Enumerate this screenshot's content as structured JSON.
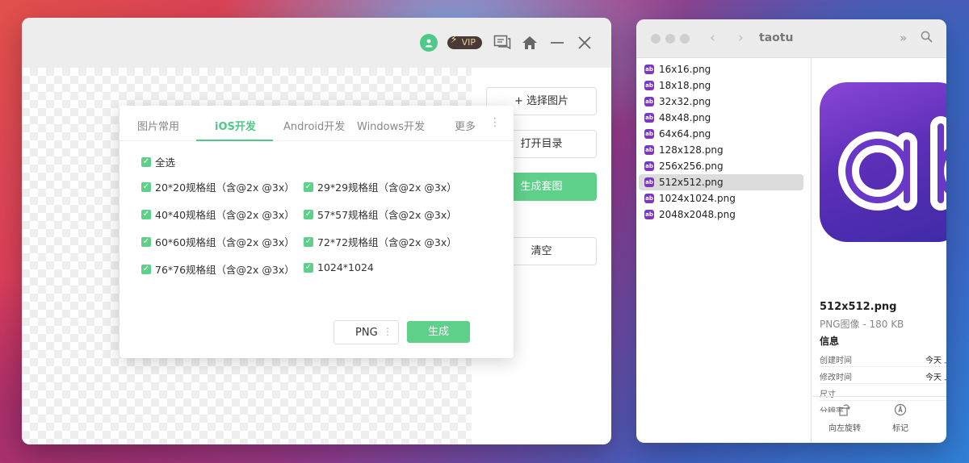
{
  "app": {
    "vip_label": "VIP",
    "sidebar_buttons": {
      "select_image": "+ 选择图片",
      "open_dir": "打开目录",
      "generate_set": "生成套图",
      "clear": "清空"
    },
    "dialog": {
      "tabs": [
        "图片常用",
        "iOS开发",
        "Android开发",
        "Windows开发",
        "更多"
      ],
      "active_tab": "iOS开发",
      "select_all": "全选",
      "options": [
        "20*20规格组（含@2x @3x）",
        "29*29规格组（含@2x @3x）",
        "40*40规格组（含@2x @3x）",
        "57*57规格组（含@2x @3x）",
        "60*60规格组（含@2x @3x）",
        "72*72规格组（含@2x @3x）",
        "76*76规格组（含@2x @3x）",
        "1024*1024"
      ],
      "format": "PNG",
      "generate": "生成"
    }
  },
  "finder": {
    "title": "taotu",
    "files": [
      "16x16.png",
      "18x18.png",
      "32x32.png",
      "48x48.png",
      "64x64.png",
      "128x128.png",
      "256x256.png",
      "512x512.png",
      "1024x1024.png",
      "2048x2048.png"
    ],
    "selected_file": "512x512.png",
    "preview": {
      "name": "512x512.png",
      "kind": "PNG图像 - 180 KB",
      "info_heading": "信息",
      "info": [
        {
          "key": "创建时间",
          "value": "今天 上"
        },
        {
          "key": "修改时间",
          "value": "今天 上"
        },
        {
          "key": "尺寸",
          "value": ""
        },
        {
          "key": "分辨率",
          "value": ""
        }
      ],
      "actions": [
        "向左旋转",
        "标记"
      ]
    }
  }
}
